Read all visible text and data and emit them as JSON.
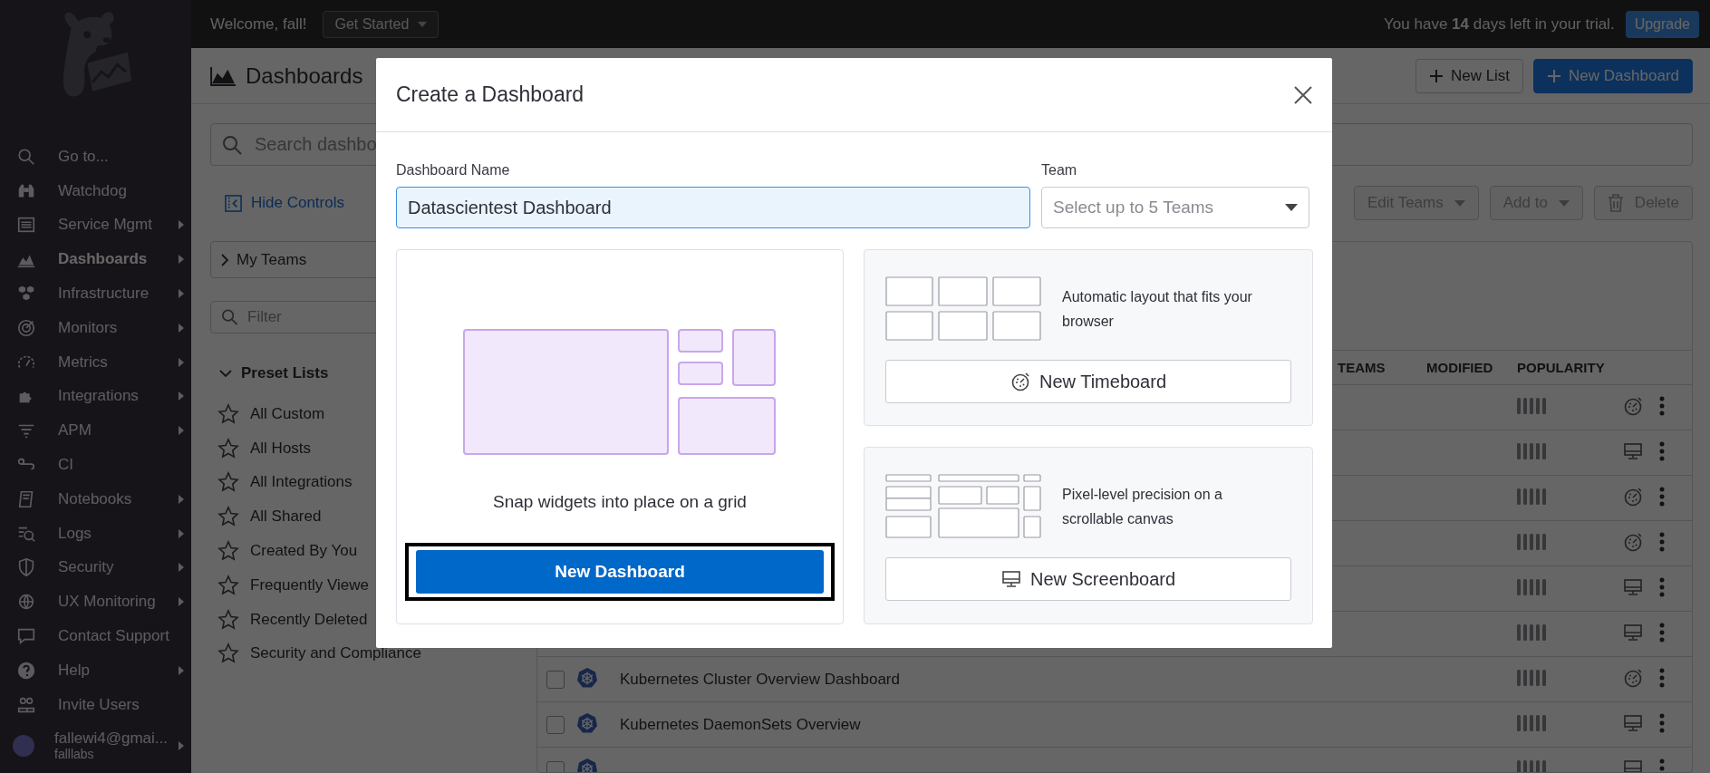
{
  "top_bar": {
    "welcome": "Welcome, fall!",
    "get_started": "Get Started",
    "trial_notice": "You have **14** days left in your trial.",
    "upgrade": "Upgrade"
  },
  "sidebar": {
    "items": [
      {
        "label": "Go to...",
        "submenu": false,
        "selected": false
      },
      {
        "label": "Watchdog",
        "submenu": false,
        "selected": false
      },
      {
        "label": "Service Mgmt",
        "submenu": true,
        "selected": false
      },
      {
        "label": "Dashboards",
        "submenu": true,
        "selected": true
      },
      {
        "label": "Infrastructure",
        "submenu": true,
        "selected": false
      },
      {
        "label": "Monitors",
        "submenu": true,
        "selected": false
      },
      {
        "label": "Metrics",
        "submenu": true,
        "selected": false
      },
      {
        "label": "Integrations",
        "submenu": true,
        "selected": false
      },
      {
        "label": "APM",
        "submenu": true,
        "selected": false
      },
      {
        "label": "CI",
        "submenu": false,
        "selected": false
      },
      {
        "label": "Notebooks",
        "submenu": true,
        "selected": false
      },
      {
        "label": "Logs",
        "submenu": true,
        "selected": false
      },
      {
        "label": "Security",
        "submenu": true,
        "selected": false
      },
      {
        "label": "UX Monitoring",
        "submenu": true,
        "selected": false
      },
      {
        "label": "Contact Support",
        "submenu": false,
        "selected": false
      },
      {
        "label": "Help",
        "submenu": true,
        "selected": false
      },
      {
        "label": "Invite Users",
        "submenu": false,
        "selected": false
      }
    ],
    "account": {
      "email": "fallewi4@gmai...",
      "org": "falllabs"
    }
  },
  "page": {
    "title": "Dashboards",
    "header_buttons": [
      {
        "label": "New List",
        "primary": false
      },
      {
        "label": "New Dashboard",
        "primary": true
      }
    ],
    "search": {
      "placeholder": "Search dashbo"
    },
    "hide_controls": "Hide Controls",
    "bulk_actions": [
      {
        "label": "Edit Teams",
        "kind": "dropdown",
        "disabled": true
      },
      {
        "label": "Add to",
        "kind": "dropdown",
        "disabled": true
      },
      {
        "label": "Delete",
        "kind": "delete",
        "disabled": true
      }
    ],
    "my_teams": {
      "label": "My Teams",
      "expanded": false
    },
    "filter": {
      "placeholder": "Filter"
    },
    "preset_lists": {
      "title": "Preset Lists",
      "expanded": true,
      "items": [
        "All Custom",
        "All Hosts",
        "All Integrations",
        "All Shared",
        "Created By You",
        "Frequently Viewe",
        "Recently Deleted",
        "Security and Compliance"
      ]
    },
    "table": {
      "columns": [
        "TEAMS",
        "MODIFIED",
        "POPULARITY"
      ],
      "rows": [
        {
          "kind": "timeboard"
        },
        {
          "kind": "screenboard"
        },
        {
          "kind": "timeboard"
        },
        {
          "kind": "timeboard"
        },
        {
          "kind": "screenboard"
        },
        {
          "kind": "screenboard"
        },
        {
          "name": "Kubernetes Cluster Overview Dashboard",
          "kind": "timeboard",
          "checked": false
        },
        {
          "name": "Kubernetes DaemonSets Overview",
          "kind": "screenboard",
          "checked": false
        },
        {
          "kind": "screenboard",
          "checked": false
        }
      ]
    }
  },
  "modal": {
    "title": "Create a Dashboard",
    "name_label": "Dashboard Name",
    "name_value": "Datascientest Dashboard",
    "team_label": "Team",
    "team_placeholder": "Select up to 5 Teams",
    "options": [
      {
        "kind": "dashboard",
        "description": "Snap widgets into place on a grid",
        "button": "New Dashboard",
        "highlighted": true
      },
      {
        "kind": "timeboard",
        "description": "Automatic layout that fits your browser",
        "button": "New Timeboard",
        "highlighted": false
      },
      {
        "kind": "screenboard",
        "description": "Pixel-level precision on a scrollable canvas",
        "button": "New Screenboard",
        "highlighted": false
      }
    ]
  }
}
